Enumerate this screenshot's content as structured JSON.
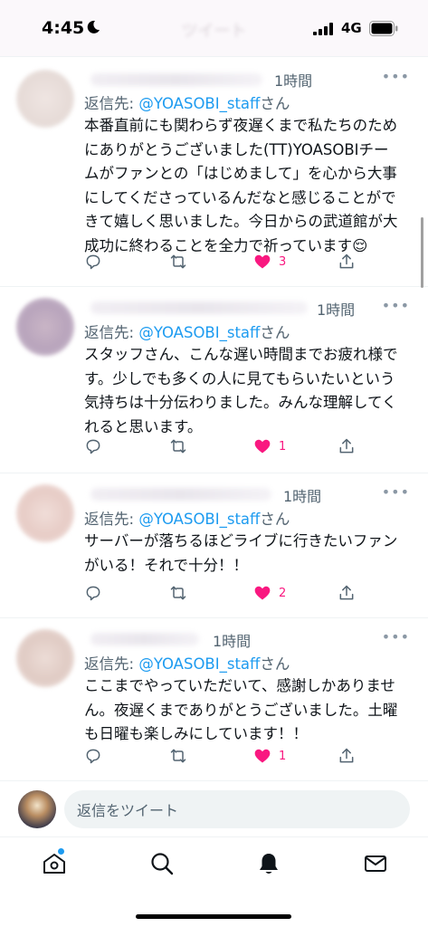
{
  "status_bar": {
    "time": "4:45",
    "network": "4G",
    "title": "ツイート"
  },
  "replies": [
    {
      "time": "1時間",
      "reply_prefix": "返信先: ",
      "handle": "@YOASOBI_staff",
      "suffix": "さん",
      "lines": [
        "本番直前にも関わらず夜遅くまで私たちのため",
        "にありがとうございました(TT)YOASOBIチー",
        "ムがファンとの「はじめまして」を心から大事",
        "にしてくださっているんだなと感じることがで",
        "きて嬉しく思いました。今日からの武道館が大",
        "成功に終わることを全力で祈っています😌"
      ],
      "likes": "3"
    },
    {
      "time": "1時間",
      "reply_prefix": "返信先: ",
      "handle": "@YOASOBI_staff",
      "suffix": "さん",
      "lines": [
        "スタッフさん、こんな遅い時間までお疲れ様で",
        "す。少しでも多くの人に見てもらいたいという",
        "気持ちは十分伝わりました。みんな理解してく",
        "れると思います。"
      ],
      "likes": "1"
    },
    {
      "time": "1時間",
      "reply_prefix": "返信先: ",
      "handle": "@YOASOBI_staff",
      "suffix": "さん",
      "lines": [
        "サーバーが落ちるほどライブに行きたいファン",
        "がいる！それで十分！！"
      ],
      "likes": "2"
    },
    {
      "time": "1時間",
      "reply_prefix": "返信先: ",
      "handle": "@YOASOBI_staff",
      "suffix": "さん",
      "lines": [
        "ここまでやっていただいて、感謝しかありませ",
        "ん。夜遅くまでありがとうございました。土曜",
        "も日曜も楽しみにしています！！"
      ],
      "likes": "1"
    }
  ],
  "composer": {
    "placeholder": "返信をツイート"
  },
  "tabs": [
    "home-icon",
    "search-icon",
    "notifications-icon",
    "messages-icon"
  ],
  "colors": {
    "accent": "#1d9bf0",
    "like": "#f91880",
    "secondary": "#536471"
  }
}
